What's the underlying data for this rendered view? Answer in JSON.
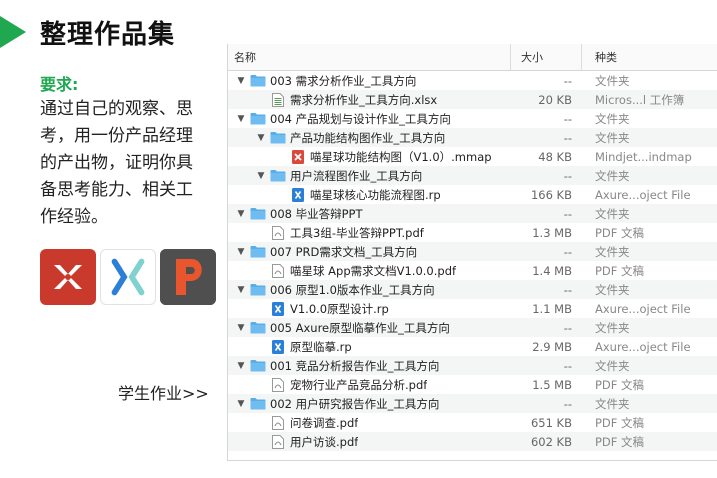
{
  "page": {
    "title": "整理作品集",
    "requirement_label": "要求:",
    "requirement_text": "通过自己的观察、思考，用一份产品经理的产出物，证明你具备思考能力、相关工作经验。",
    "student_link": "学生作业>>"
  },
  "apps": [
    {
      "name": "xmind-icon"
    },
    {
      "name": "axure-icon"
    },
    {
      "name": "ppt-icon"
    }
  ],
  "finder": {
    "columns": {
      "name": "名称",
      "size": "大小",
      "kind": "种类"
    },
    "rows": [
      {
        "name": "003 需求分析作业_工具方向",
        "size": "--",
        "kind": "文件夹",
        "type": "folder",
        "level": 0
      },
      {
        "name": "需求分析作业_工具方向.xlsx",
        "size": "20 KB",
        "kind": "Micros...l 工作簿",
        "type": "xlsx",
        "level": 1
      },
      {
        "name": "004 产品规划与设计作业_工具方向",
        "size": "--",
        "kind": "文件夹",
        "type": "folder",
        "level": 0
      },
      {
        "name": "产品功能结构图作业_工具方向",
        "size": "--",
        "kind": "文件夹",
        "type": "folder",
        "level": 1
      },
      {
        "name": "喵星球功能结构图（V1.0）.mmap",
        "size": "48 KB",
        "kind": "Mindjet...indmap",
        "type": "mmap",
        "level": 2
      },
      {
        "name": "用户流程图作业_工具方向",
        "size": "--",
        "kind": "文件夹",
        "type": "folder",
        "level": 1
      },
      {
        "name": "喵星球核心功能流程图.rp",
        "size": "166 KB",
        "kind": "Axure...oject File",
        "type": "rp",
        "level": 2
      },
      {
        "name": "008 毕业答辩PPT",
        "size": "--",
        "kind": "文件夹",
        "type": "folder",
        "level": 0
      },
      {
        "name": "工具3组-毕业答辩PPT.pdf",
        "size": "1.3 MB",
        "kind": "PDF 文稿",
        "type": "pdf",
        "level": 1
      },
      {
        "name": "007 PRD需求文档_工具方向",
        "size": "--",
        "kind": "文件夹",
        "type": "folder",
        "level": 0
      },
      {
        "name": "喵星球 App需求文档V1.0.0.pdf",
        "size": "1.4 MB",
        "kind": "PDF 文稿",
        "type": "pdf",
        "level": 1
      },
      {
        "name": "006 原型1.0版本作业_工具方向",
        "size": "--",
        "kind": "文件夹",
        "type": "folder",
        "level": 0
      },
      {
        "name": "V1.0.0原型设计.rp",
        "size": "1.1 MB",
        "kind": "Axure...oject File",
        "type": "rp",
        "level": 1
      },
      {
        "name": "005 Axure原型临摹作业_工具方向",
        "size": "--",
        "kind": "文件夹",
        "type": "folder",
        "level": 0
      },
      {
        "name": "原型临摹.rp",
        "size": "2.9 MB",
        "kind": "Axure...oject File",
        "type": "rp",
        "level": 1
      },
      {
        "name": "001 竞品分析报告作业_工具方向",
        "size": "--",
        "kind": "文件夹",
        "type": "folder",
        "level": 0
      },
      {
        "name": "宠物行业产品竞品分析.pdf",
        "size": "1.5 MB",
        "kind": "PDF 文稿",
        "type": "pdf",
        "level": 1
      },
      {
        "name": "002 用户研究报告作业_工具方向",
        "size": "--",
        "kind": "文件夹",
        "type": "folder",
        "level": 0
      },
      {
        "name": "问卷调查.pdf",
        "size": "651 KB",
        "kind": "PDF 文稿",
        "type": "pdf",
        "level": 1
      },
      {
        "name": "用户访谈.pdf",
        "size": "602 KB",
        "kind": "PDF 文稿",
        "type": "pdf",
        "level": 1
      }
    ]
  },
  "colors": {
    "accent_green": "#1fa84f",
    "folder_blue": "#5aaee8"
  }
}
